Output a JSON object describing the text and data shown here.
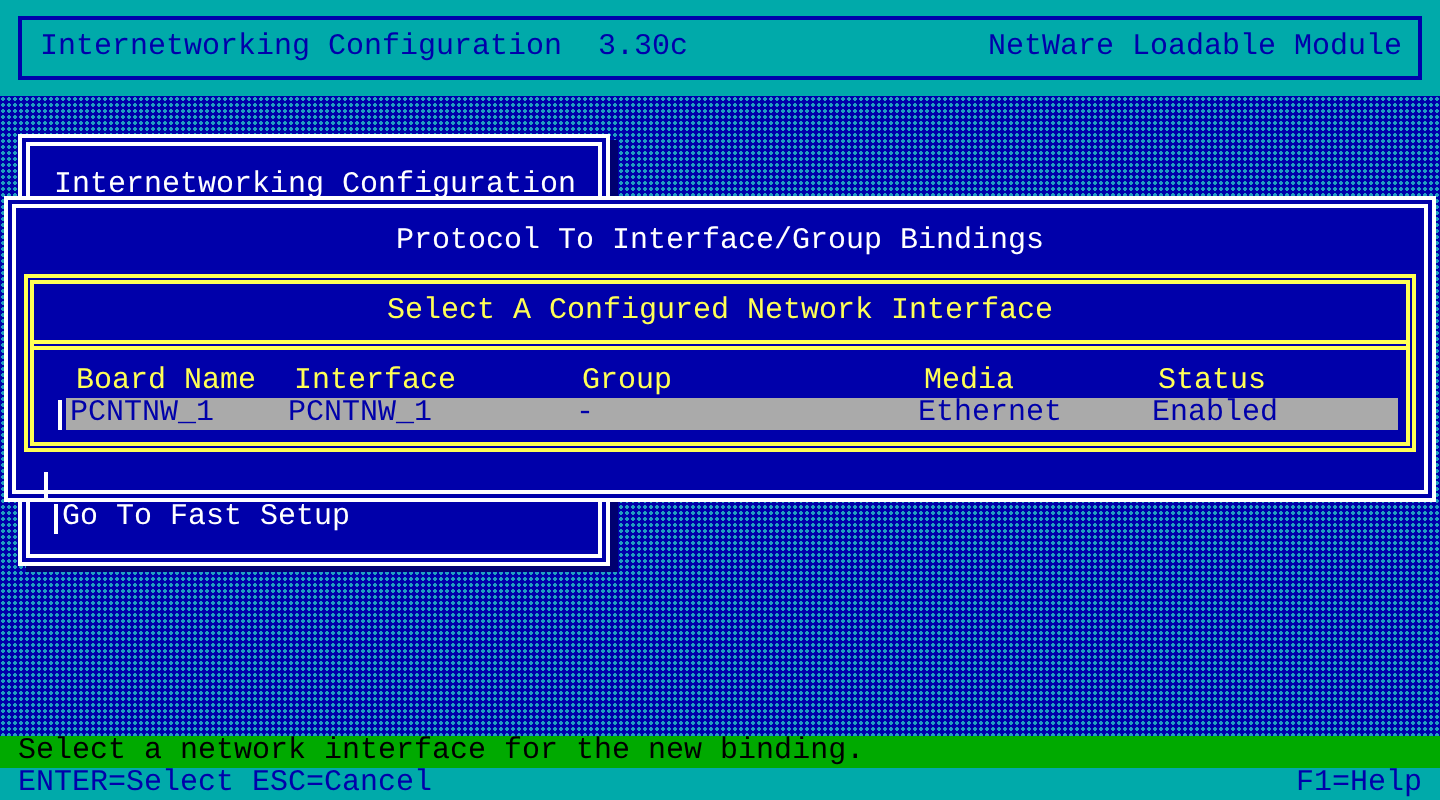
{
  "header": {
    "title": "Internetworking Configuration  3.30c",
    "module": "NetWare Loadable Module"
  },
  "main_menu": {
    "title": "Internetworking Configuration",
    "items": [
      {
        "label": "Go To Fast Setup"
      }
    ]
  },
  "bindings_window": {
    "title": "Protocol To Interface/Group Bindings"
  },
  "interface_list": {
    "title": "Select A Configured Network Interface",
    "columns": [
      "Board Name",
      "Interface",
      "Group",
      "Media",
      "Status"
    ],
    "rows": [
      {
        "cells": [
          "PCNTNW_1",
          "PCNTNW_1",
          "-",
          "Ethernet",
          "Enabled"
        ],
        "selected": true
      }
    ]
  },
  "prompt": "Select a network interface for the new binding.",
  "key_help": {
    "left": "ENTER=Select ESC=Cancel",
    "right": "F1=Help"
  }
}
